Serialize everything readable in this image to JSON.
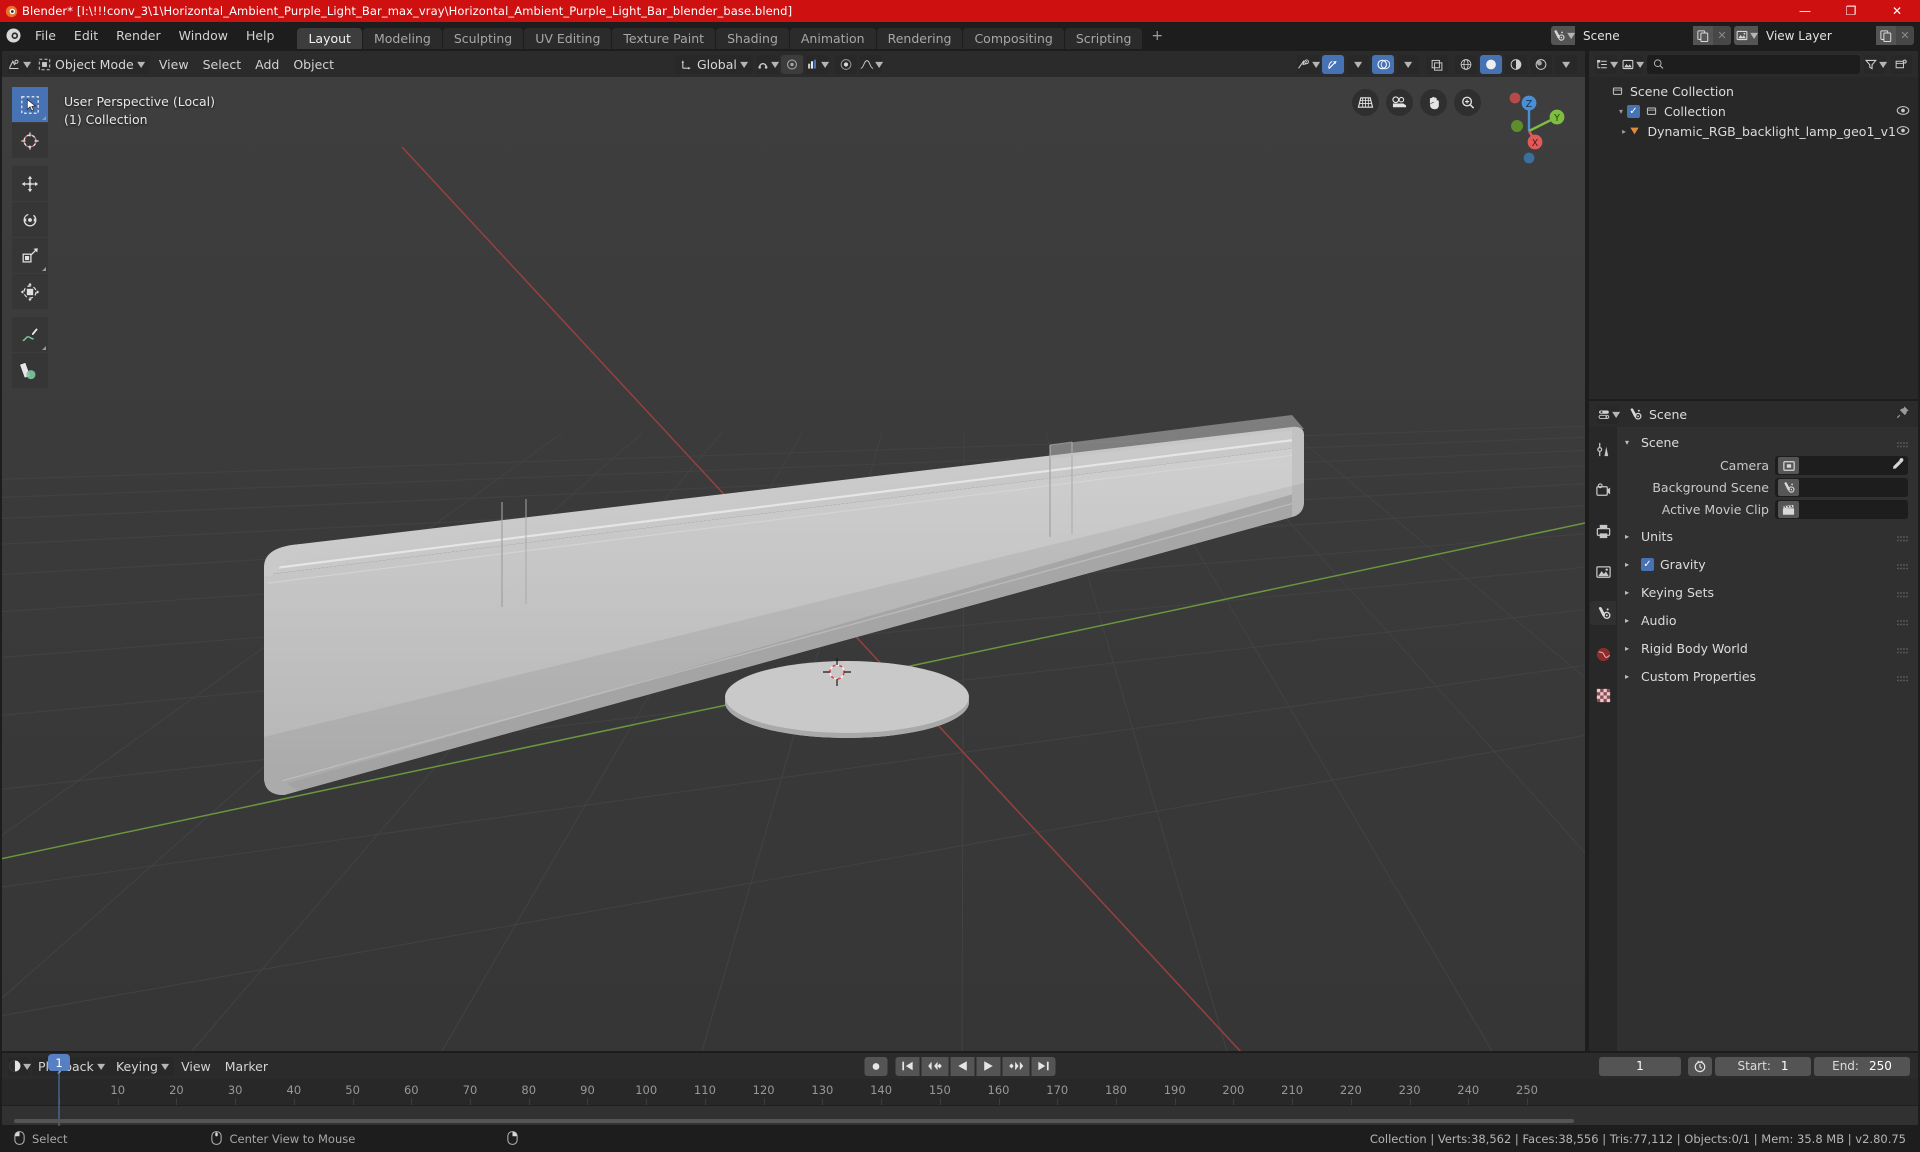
{
  "window": {
    "title": "Blender* [I:\\!!!conv_3\\1\\Horizontal_Ambient_Purple_Light_Bar_max_vray\\Horizontal_Ambient_Purple_Light_Bar_blender_base.blend]",
    "minimize": "—",
    "maximize": "❐",
    "close": "✕"
  },
  "menu": {
    "items": [
      "File",
      "Edit",
      "Render",
      "Window",
      "Help"
    ]
  },
  "workspaces": {
    "tabs": [
      "Layout",
      "Modeling",
      "Sculpting",
      "UV Editing",
      "Texture Paint",
      "Shading",
      "Animation",
      "Rendering",
      "Compositing",
      "Scripting"
    ],
    "active": "Layout",
    "add": "+"
  },
  "topbar_right": {
    "scene_name": "Scene",
    "viewlayer_name": "View Layer"
  },
  "viewport_header": {
    "mode": "Object Mode",
    "menus": [
      "View",
      "Select",
      "Add",
      "Object"
    ],
    "transform_orientation": "Global"
  },
  "viewport": {
    "overlay_line1": "User Perspective (Local)",
    "overlay_line2": "(1) Collection",
    "gizmo_axes": [
      "X",
      "Y",
      "Z"
    ],
    "nav_icons": [
      "grid-icon",
      "camera-icon",
      "hand-icon",
      "zoom-icon"
    ],
    "tools": [
      "tweak-select-tool",
      "cursor-tool",
      "move-tool",
      "rotate-tool",
      "scale-tool",
      "transform-tool",
      "annotate-tool",
      "measure-tool"
    ]
  },
  "outliner": {
    "search_placeholder": "",
    "rows": [
      {
        "label": "Scene Collection",
        "icon": "collection-icon",
        "depth": 0,
        "has_eye": false,
        "has_check": false,
        "disclosure": ""
      },
      {
        "label": "Collection",
        "icon": "collection-icon",
        "depth": 1,
        "has_eye": true,
        "has_check": true,
        "disclosure": "▾"
      },
      {
        "label": "Dynamic_RGB_backlight_lamp_geo1_v1",
        "icon": "mesh-icon",
        "depth": 2,
        "has_eye": true,
        "has_check": false,
        "disclosure": "▸"
      }
    ]
  },
  "properties": {
    "breadcrumb": "Scene",
    "panels": [
      {
        "label": "Scene",
        "open": true,
        "tri": "▾",
        "checkbox": null
      },
      {
        "label": "Units",
        "open": false,
        "tri": "▸",
        "checkbox": null
      },
      {
        "label": "Gravity",
        "open": false,
        "tri": "▸",
        "checkbox": true
      },
      {
        "label": "Keying Sets",
        "open": false,
        "tri": "▸",
        "checkbox": null
      },
      {
        "label": "Audio",
        "open": false,
        "tri": "▸",
        "checkbox": null
      },
      {
        "label": "Rigid Body World",
        "open": false,
        "tri": "▸",
        "checkbox": null
      },
      {
        "label": "Custom Properties",
        "open": false,
        "tri": "▸",
        "checkbox": null
      }
    ],
    "scene_fields": [
      {
        "label": "Camera",
        "value": "",
        "icon": "camera-field-icon",
        "eyedropper": true
      },
      {
        "label": "Background Scene",
        "value": "",
        "icon": "scene-field-icon",
        "eyedropper": false
      },
      {
        "label": "Active Movie Clip",
        "value": "",
        "icon": "clip-field-icon",
        "eyedropper": false
      }
    ],
    "tab_icons": [
      "tool-tab",
      "render-tab",
      "output-tab",
      "viewlayer-tab",
      "scene-tab",
      "world-tab",
      "texture-tab"
    ],
    "active_tab": "scene-tab"
  },
  "timeline": {
    "menus": [
      "Playback",
      "Keying",
      "View",
      "Marker"
    ],
    "transport": [
      "record-icon",
      "jump-start-icon",
      "prev-keyframe-icon",
      "play-reverse-icon",
      "play-icon",
      "next-keyframe-icon",
      "jump-end-icon"
    ],
    "current_frame": "1",
    "start_label": "Start:",
    "start_value": "1",
    "end_label": "End:",
    "end_value": "250",
    "ruler_ticks": [
      "1",
      "10",
      "20",
      "30",
      "40",
      "50",
      "60",
      "70",
      "80",
      "90",
      "100",
      "110",
      "120",
      "130",
      "140",
      "150",
      "160",
      "170",
      "180",
      "190",
      "200",
      "210",
      "220",
      "230",
      "240",
      "250"
    ],
    "playhead_frame": "1"
  },
  "statusbar": {
    "left_items": [
      {
        "icon": "mouse-left-icon",
        "label": "Select"
      },
      {
        "icon": "mouse-middle-icon",
        "label": "Center View to Mouse"
      },
      {
        "icon": "mouse-right-icon",
        "label": ""
      }
    ],
    "stats": "Collection | Verts:38,562 | Faces:38,556 | Tris:77,112 | Objects:0/1 | Mem: 35.8 MB | v2.80.75"
  },
  "colors": {
    "title_red": "#cf1010",
    "accent_blue": "#4772b3",
    "axis_x_red": "#e05a5a",
    "axis_y_green": "#7fbf3f",
    "axis_z_blue": "#4a8fd6"
  }
}
